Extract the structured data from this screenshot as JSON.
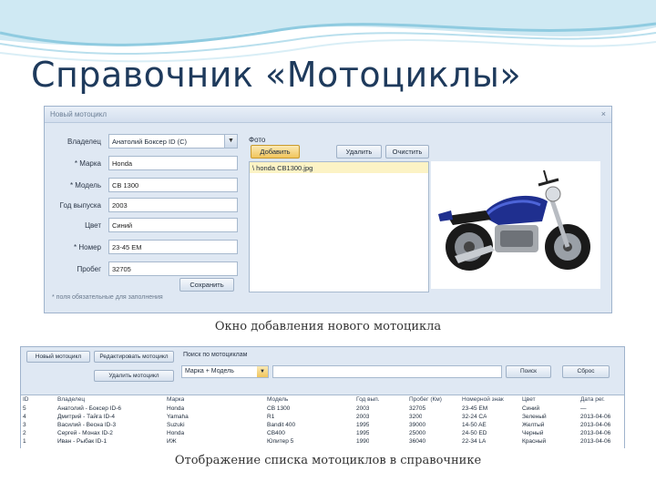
{
  "slide": {
    "title": "Справочник «Мотоциклы»",
    "caption_top": "Окно добавления нового мотоцикла",
    "caption_bottom": "Отображение списка мотоциклов в справочнике"
  },
  "dialog": {
    "title": "Новый мотоцикл",
    "close": "×",
    "fields": [
      {
        "label": "Владелец",
        "value": "Анатолий Боксер ID (С)",
        "type": "select"
      },
      {
        "label": "* Марка",
        "value": "Honda",
        "type": "input"
      },
      {
        "label": "* Модель",
        "value": "CB 1300",
        "type": "input"
      },
      {
        "label": "Год выпуска",
        "value": "2003",
        "type": "input"
      },
      {
        "label": "Цвет",
        "value": "Синий",
        "type": "input"
      },
      {
        "label": "* Номер",
        "value": "23-45 EM",
        "type": "input"
      },
      {
        "label": "Пробег",
        "value": "32705",
        "type": "input"
      }
    ],
    "photo_label": "Фото",
    "add_button": "Добавить",
    "delete_button": "Удалить",
    "clear_button": "Очистить",
    "file_name": "\\ honda CB1300.jpg",
    "save_button": "Сохранить",
    "footnote": "* поля обязательные для заполнения"
  },
  "list": {
    "new_button": "Новый мотоцикл",
    "edit_button": "Редактировать мотоцикл",
    "delete_button": "Удалить мотоцикл",
    "search_label": "Поиск по мотоциклам",
    "search_field": "Марка + Модель",
    "search_button": "Поиск",
    "reset_button": "Сброс",
    "columns": [
      "ID",
      "Владелец",
      "Марка",
      "Модель",
      "Год вып.",
      "Пробег (Км)",
      "Номерной знак",
      "Цвет",
      "Дата рег."
    ],
    "rows": [
      [
        "5",
        "Анатолий - Боксер ID-6",
        "Honda",
        "CB 1300",
        "2003",
        "32705",
        "23-45 EM",
        "Синий",
        "—"
      ],
      [
        "4",
        "Дмитрий - Тайга ID-4",
        "Yamaha",
        "R1",
        "2003",
        "3200",
        "32-24 CA",
        "Зеленый",
        "2013-04-06"
      ],
      [
        "3",
        "Василий - Весна ID-3",
        "Suzuki",
        "Bandit 400",
        "1995",
        "39000",
        "14-50 AE",
        "Желтый",
        "2013-04-06"
      ],
      [
        "2",
        "Сергей - Монах ID-2",
        "Honda",
        "CB400",
        "1995",
        "25000",
        "24-50 ED",
        "Черный",
        "2013-04-06"
      ],
      [
        "1",
        "Иван - Рыбак ID-1",
        "ИЖ",
        "Юпитер 5",
        "1990",
        "36040",
        "22-34 LA",
        "Красный",
        "2013-04-06"
      ]
    ]
  },
  "colors": {
    "title": "#1e3a5c",
    "window_bg": "#dfe8f3",
    "accent_button": "#f1c55c"
  }
}
